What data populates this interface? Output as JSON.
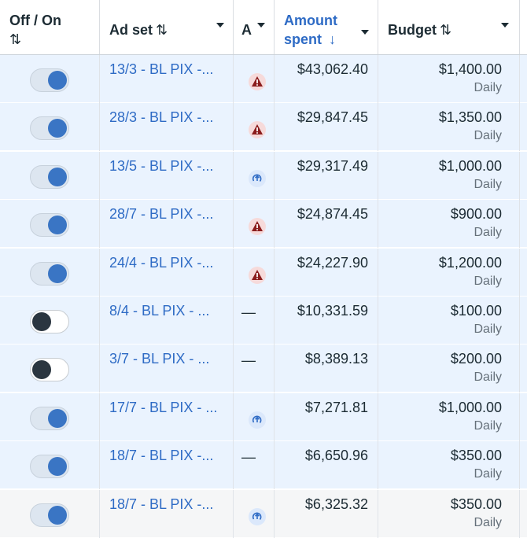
{
  "headers": {
    "toggle": "Off / On",
    "toggle_sort": "⇅",
    "adset": "Ad set",
    "adset_sort": "⇅",
    "attention": "A",
    "amount_line1": "Amount",
    "amount_line2": "spent",
    "amount_sort": "↓",
    "budget": "Budget",
    "budget_sort": "⇅"
  },
  "colors": {
    "accent": "#2e6bc5",
    "warning": "#8b1d1d",
    "selected_row": "#eaf3fe"
  },
  "rows": [
    {
      "on": true,
      "name": "13/3 - BL PIX -...",
      "status": "warning",
      "amount": "$43,062.40",
      "budget": "$1,400.00",
      "period": "Daily"
    },
    {
      "on": true,
      "name": "28/3 - BL PIX -...",
      "status": "warning",
      "amount": "$29,847.45",
      "budget": "$1,350.00",
      "period": "Daily"
    },
    {
      "on": true,
      "name": "13/5 - BL PIX -...",
      "status": "learning",
      "amount": "$29,317.49",
      "budget": "$1,000.00",
      "period": "Daily"
    },
    {
      "on": true,
      "name": "28/7 - BL PIX -...",
      "status": "warning",
      "amount": "$24,874.45",
      "budget": "$900.00",
      "period": "Daily"
    },
    {
      "on": true,
      "name": "24/4 - BL PIX -...",
      "status": "warning",
      "amount": "$24,227.90",
      "budget": "$1,200.00",
      "period": "Daily"
    },
    {
      "on": false,
      "name": "8/4 - BL PIX - ...",
      "status": "none",
      "dash": "—",
      "amount": "$10,331.59",
      "budget": "$100.00",
      "period": "Daily"
    },
    {
      "on": false,
      "name": "3/7 - BL PIX - ...",
      "status": "none",
      "dash": "—",
      "amount": "$8,389.13",
      "budget": "$200.00",
      "period": "Daily"
    },
    {
      "on": true,
      "name": "17/7 - BL PIX - ...",
      "status": "learning",
      "amount": "$7,271.81",
      "budget": "$1,000.00",
      "period": "Daily"
    },
    {
      "on": true,
      "name": "18/7 - BL PIX -...",
      "status": "none",
      "dash": "—",
      "amount": "$6,650.96",
      "budget": "$350.00",
      "period": "Daily"
    },
    {
      "on": true,
      "name": "18/7 - BL PIX -...",
      "status": "learning",
      "amount": "$6,325.32",
      "budget": "$350.00",
      "period": "Daily"
    }
  ]
}
